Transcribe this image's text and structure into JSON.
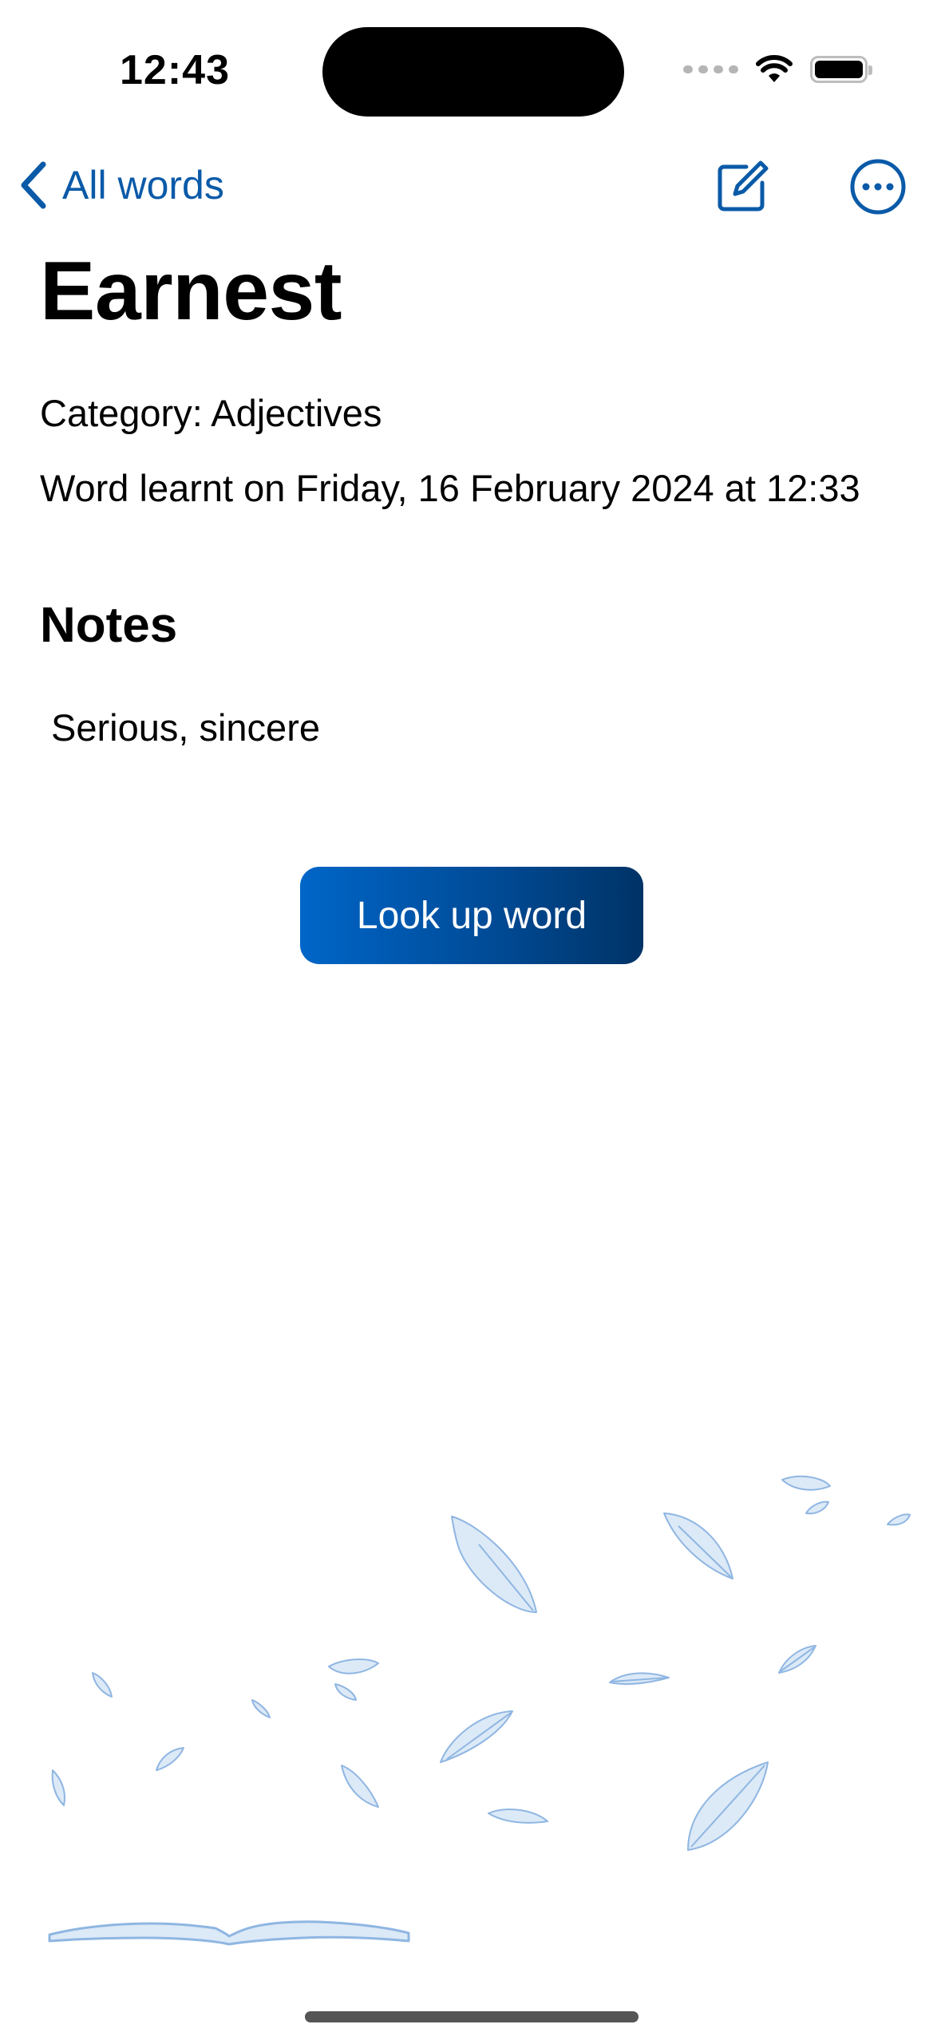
{
  "status_bar": {
    "time": "12:43"
  },
  "nav": {
    "back_label": "All words",
    "accent_color": "#0a5aa8"
  },
  "word": {
    "title": "Earnest",
    "category": "Category: Adjectives",
    "learnt": "Word learnt on Friday, 16 February 2024 at 12:33"
  },
  "notes": {
    "heading": "Notes",
    "text": "Serious, sincere"
  },
  "actions": {
    "lookup_label": "Look up word"
  },
  "icons": {
    "back": "chevron-left-icon",
    "edit": "square-and-pencil-icon",
    "more": "ellipsis-circle-icon",
    "wifi": "wifi-icon",
    "battery": "battery-icon"
  }
}
